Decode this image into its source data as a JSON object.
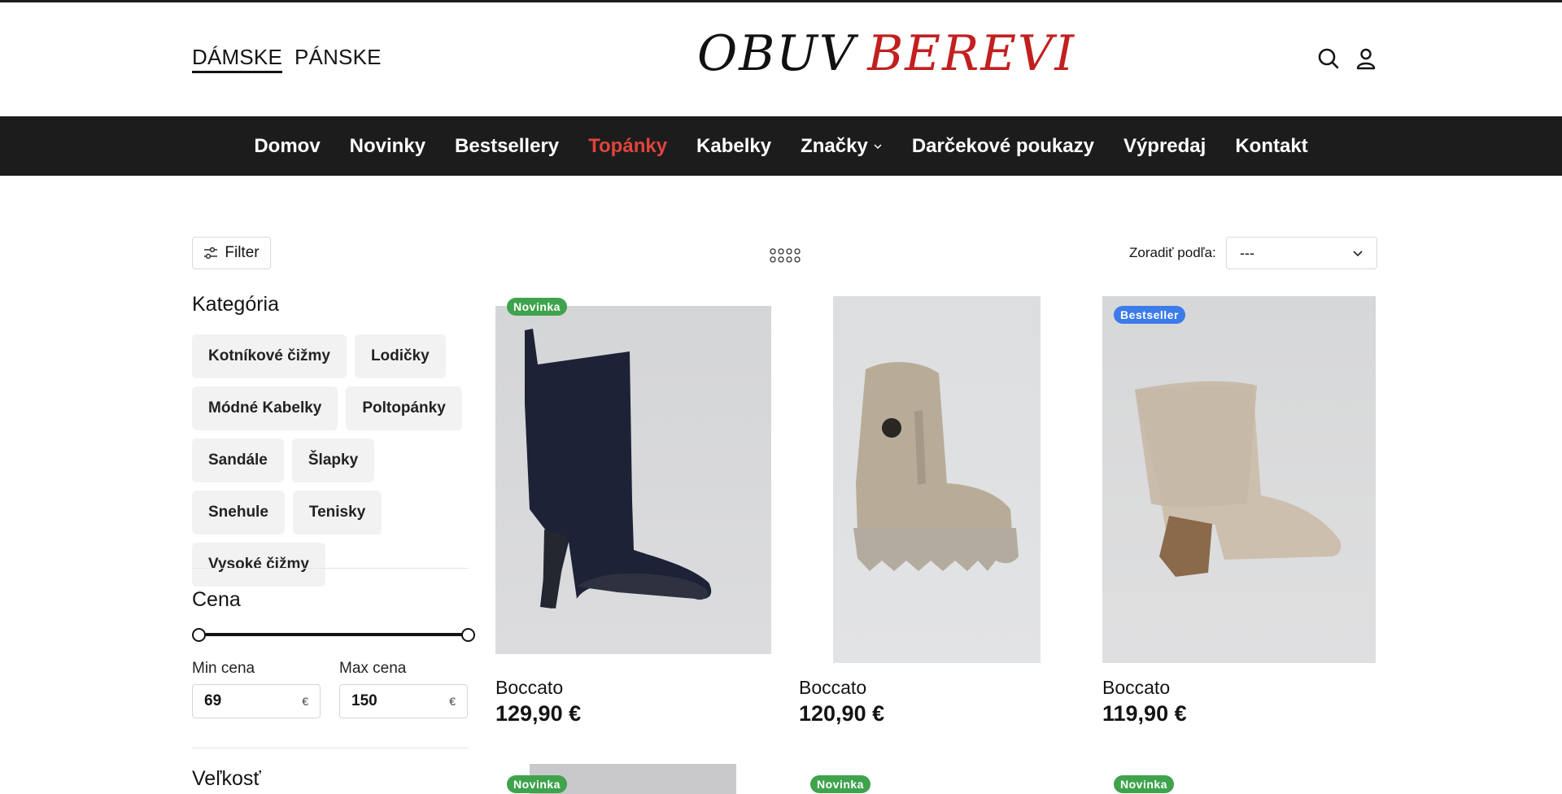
{
  "header": {
    "genders": [
      "DÁMSKE",
      "PÁNSKE"
    ],
    "logo_left": "OBUV",
    "logo_right": "BEREVI"
  },
  "nav": {
    "items": [
      "Domov",
      "Novinky",
      "Bestsellery",
      "Topánky",
      "Kabelky",
      "Značky",
      "Darčekové poukazy",
      "Výpredaj",
      "Kontakt"
    ],
    "active": "Topánky"
  },
  "toolbar": {
    "filter_label": "Filter",
    "sort_label": "Zoradiť podľa:",
    "sort_value": "---"
  },
  "sidebar": {
    "category_title": "Kategória",
    "categories": [
      "Kotníkové čižmy",
      "Lodičky",
      "Módné Kabelky",
      "Poltopánky",
      "Sandále",
      "Šlapky",
      "Snehule",
      "Tenisky",
      "Vysoké čižmy"
    ],
    "price_title": "Cena",
    "min_label": "Min cena",
    "max_label": "Max cena",
    "min_value": "69",
    "max_value": "150",
    "currency": "€",
    "size_title": "Veľkosť"
  },
  "products": [
    {
      "badge": "Novinka",
      "name": "Boccato",
      "price": "129,90 €"
    },
    {
      "badge": "",
      "name": "Boccato",
      "price": "120,90 €"
    },
    {
      "badge": "Bestseller",
      "name": "Boccato",
      "price": "119,90 €"
    }
  ],
  "next_row_badges": [
    "Novinka",
    "Novinka",
    "Novinka"
  ],
  "colors": {
    "nav_bg": "#1c1c1c",
    "nav_active": "#e0453c",
    "logo_red": "#c21f1f",
    "badge_new": "#3fa34d",
    "badge_bestseller": "#3b7bea"
  }
}
